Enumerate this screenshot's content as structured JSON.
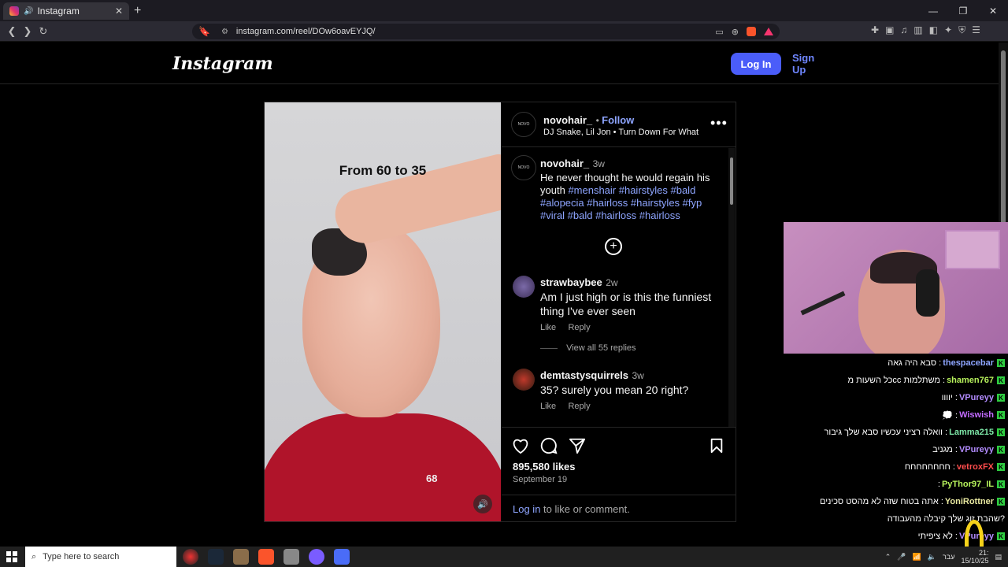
{
  "browser": {
    "tab_title": "Instagram",
    "url": "instagram.com/reel/DOw6oavEYJQ/"
  },
  "ig": {
    "logo": "Instagram",
    "login_label": "Log In",
    "signup_label": "Sign Up",
    "post": {
      "username": "novohair_",
      "follow_label": "Follow",
      "audio": "DJ Snake, Lil Jon • Turn Down For What",
      "overlay_text": "From 60 to 35",
      "shirt_logo": "68",
      "caption": {
        "username": "novohair_",
        "time": "3w",
        "text": "He never thought he would regain his youth",
        "tags": "#menshair #hairstyles #bald #alopecia #hairloss #hairstyles #fyp #viral #bald #hairloss #hairloss"
      },
      "comments": [
        {
          "username": "strawbaybee",
          "time": "2w",
          "text": "Am I just high or is this the funniest thing I've ever seen",
          "like_label": "Like",
          "reply_label": "Reply",
          "view_replies": "View all 55 replies"
        },
        {
          "username": "demtastysquirrels",
          "time": "3w",
          "text": "35? surely you mean 20 right?",
          "like_label": "Like",
          "reply_label": "Reply"
        }
      ],
      "likes": "895,580 likes",
      "date": "September 19",
      "login_link": "Log in",
      "login_rest": " to like or comment."
    }
  },
  "chat": {
    "messages": [
      {
        "nick": "thespacebar",
        "text": " : סבא היה גאה",
        "color": "#8ea5ff"
      },
      {
        "nick": "shamen767",
        "text": " : משתלמות ccכל השעות מ",
        "color": "#b7f25c"
      },
      {
        "nick": "VPureyy",
        "text": " : יוווו",
        "color": "#b38cff"
      },
      {
        "nick": "Wiswish",
        "text": " : 💭",
        "color": "#c26bff"
      },
      {
        "nick": "Lamma215",
        "text": " : וואלה רציני עכשיו סבא שלך גיבור",
        "color": "#7ee8a8"
      },
      {
        "nick": "VPureyy",
        "text": " : מגניב",
        "color": "#b38cff"
      },
      {
        "nick": "vetroxFX",
        "text": " : חחחחחחחח",
        "color": "#ff4d4d"
      },
      {
        "nick": "PyThor97_IL",
        "text": " : ",
        "color": "#b7f25c"
      },
      {
        "nick": "YoniRottner",
        "text": " : אתה בטוח שזה לא מהסט סכינים",
        "color": "#e8e8a0"
      },
      {
        "nick": "",
        "text": "?שהבת זוג שלך קיבלה מהעבודה",
        "color": "#ffffff"
      },
      {
        "nick": "VPureyy",
        "text": " : לא ציפיתי",
        "color": "#b38cff"
      }
    ]
  },
  "taskbar": {
    "search_placeholder": "Type here to search",
    "lang": "עבר",
    "time": "21:",
    "date": "15/10/25"
  }
}
